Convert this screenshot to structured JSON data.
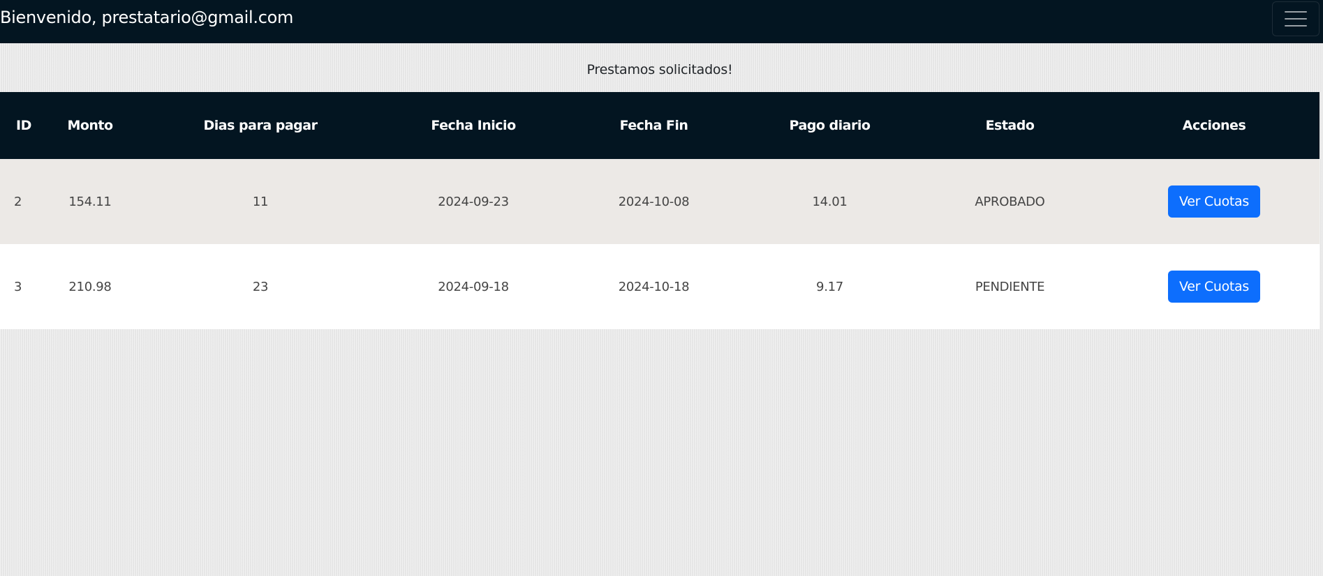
{
  "navbar": {
    "welcome_text": "Bienvenido, prestatario@gmail.com",
    "menu_icon": "hamburger-menu-icon"
  },
  "main": {
    "title": "Prestamos solicitados!"
  },
  "table": {
    "headers": [
      "ID",
      "Monto",
      "Dias para pagar",
      "Fecha Inicio",
      "Fecha Fin",
      "Pago diario",
      "Estado",
      "Acciones"
    ],
    "rows": [
      {
        "id": "2",
        "monto": "154.11",
        "dias": "11",
        "fecha_inicio": "2024-09-23",
        "fecha_fin": "2024-10-08",
        "pago_diario": "14.01",
        "estado": "APROBADO",
        "accion_label": "Ver Cuotas"
      },
      {
        "id": "3",
        "monto": "210.98",
        "dias": "23",
        "fecha_inicio": "2024-09-18",
        "fecha_fin": "2024-10-18",
        "pago_diario": "9.17",
        "estado": "PENDIENTE",
        "accion_label": "Ver Cuotas"
      }
    ]
  },
  "colors": {
    "navbar_bg": "#031521",
    "button_primary": "#0d6efd",
    "row_alt_bg": "#ece9e6"
  }
}
